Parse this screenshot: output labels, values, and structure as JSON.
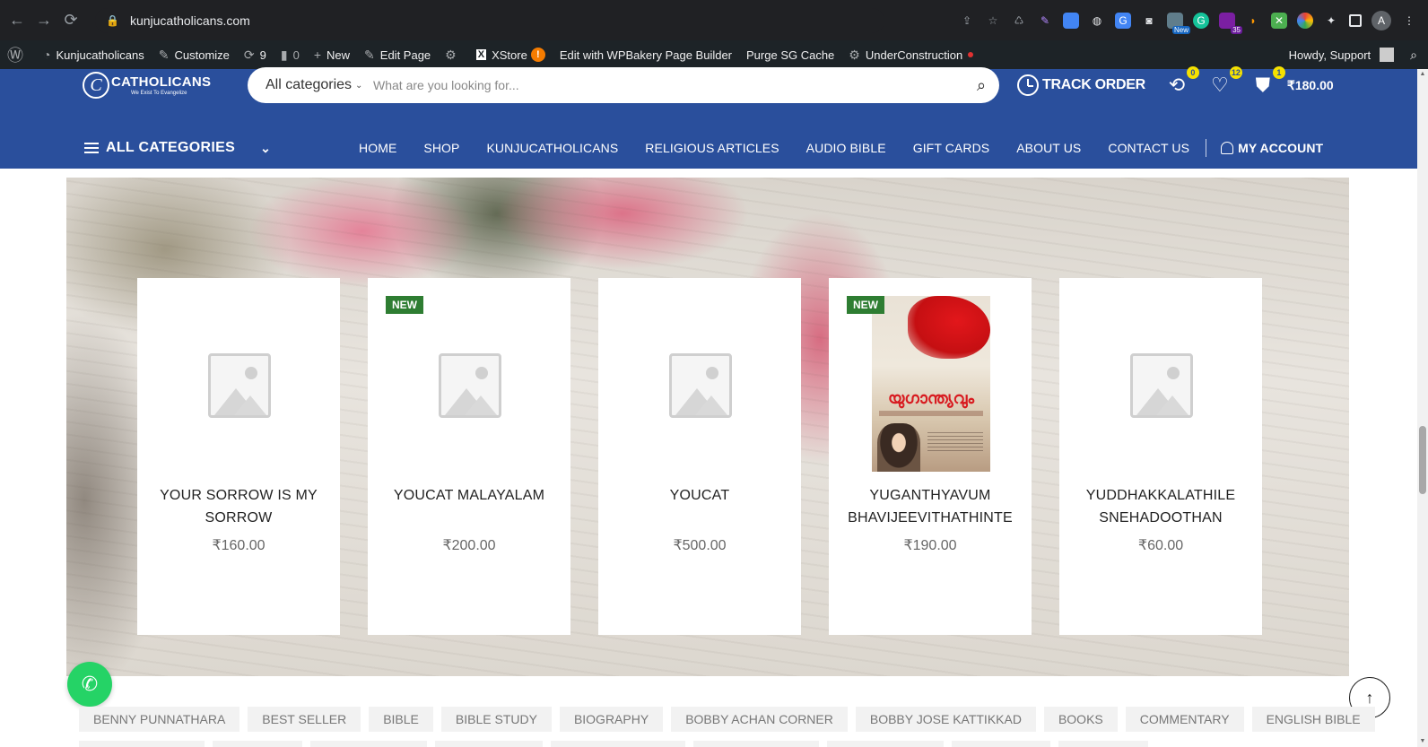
{
  "browser": {
    "url": "kunjucatholicans.com",
    "extensions": [
      {
        "icon": "share-icon"
      },
      {
        "icon": "star-icon"
      },
      {
        "icon": "recycle-icon"
      },
      {
        "icon": "pen-icon"
      },
      {
        "icon": "docs-icon"
      },
      {
        "icon": "globe-icon"
      },
      {
        "icon": "translate-icon"
      },
      {
        "icon": "camera-icon"
      },
      {
        "icon": "new-ext-icon",
        "badge": "New"
      },
      {
        "icon": "grammarly-icon"
      },
      {
        "icon": "purple-ext-icon",
        "badge": "35"
      },
      {
        "icon": "orange-ext-icon"
      },
      {
        "icon": "x-ext-icon"
      },
      {
        "icon": "color-ext-icon"
      },
      {
        "icon": "puzzle-icon"
      },
      {
        "icon": "sidebar-icon"
      }
    ],
    "profile_initial": "A"
  },
  "wp_bar": {
    "site": "Kunjucatholicans",
    "customize": "Customize",
    "updates": "9",
    "comments": "0",
    "new": "New",
    "edit_page": "Edit Page",
    "xstore": "XStore",
    "xstore_badge": "!",
    "wpbakery": "Edit with WPBakery Page Builder",
    "purge": "Purge SG Cache",
    "under_construction": "UnderConstruction",
    "howdy": "Howdy, Support"
  },
  "header": {
    "logo_name": "CATHOLICANS",
    "logo_tagline": "We Exist To Evangelize",
    "category_select": "All categories",
    "search_placeholder": "What are you looking for...",
    "track_order": "TRACK ORDER",
    "compare_count": "0",
    "wishlist_count": "12",
    "cart_count": "1",
    "cart_total": "₹180.00",
    "all_categories": "ALL CATEGORIES",
    "menu": [
      "HOME",
      "SHOP",
      "KUNJUCATHOLICANS",
      "RELIGIOUS ARTICLES",
      "AUDIO BIBLE",
      "GIFT CARDS",
      "ABOUT US",
      "CONTACT US"
    ],
    "account": "MY ACCOUNT"
  },
  "products": [
    {
      "title_line1": "YOUR SORROW IS MY",
      "title_line2": "SORROW",
      "price": "₹160.00",
      "badge": "",
      "image": "placeholder"
    },
    {
      "title_line1": "YOUCAT MALAYALAM",
      "title_line2": "",
      "price": "₹200.00",
      "badge": "NEW",
      "image": "placeholder"
    },
    {
      "title_line1": "YOUCAT",
      "title_line2": "",
      "price": "₹500.00",
      "badge": "",
      "image": "placeholder"
    },
    {
      "title_line1": "YUGANTHYAVUM",
      "title_line2": "BHAVIJEEVITHATHINTE",
      "price": "₹190.00",
      "badge": "NEW",
      "image": "book-cover",
      "cover_title": "യുഗാന്ത്യവും"
    },
    {
      "title_line1": "YUDDHAKKALATHILE",
      "title_line2": "SNEHADOOTHAN",
      "price": "₹60.00",
      "badge": "",
      "image": "placeholder"
    }
  ],
  "tags": [
    "BENNY PUNNATHARA",
    "BEST SELLER",
    "BIBLE",
    "BIBLE STUDY",
    "BIOGRAPHY",
    "BOBBY ACHAN CORNER",
    "BOBBY JOSE KATTIKKAD",
    "BOOKS",
    "COMMENTARY",
    "ENGLISH BIBLE"
  ],
  "colors": {
    "header_blue": "#2a4f9c",
    "badge_green": "#2e7d32",
    "whatsapp_green": "#25d366",
    "badge_yellow": "#f5e100"
  }
}
